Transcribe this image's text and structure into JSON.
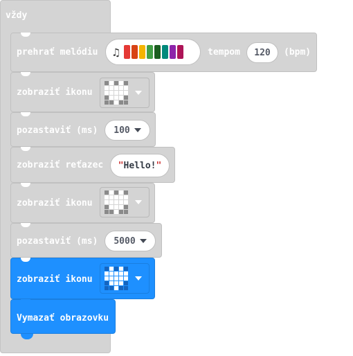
{
  "forever": {
    "label": "vždy"
  },
  "melody": {
    "label": "prehrať melódiu",
    "tempo_label": "tempom",
    "tempo_value": "120",
    "unit": "(bpm)",
    "note_icon": "music-note-icon",
    "colors": [
      "#e53935",
      "#d84315",
      "#f4b400",
      "#43a047",
      "#1b5e20",
      "#00897b",
      "#8e24aa",
      "#ad1457"
    ]
  },
  "show_icon_1": {
    "label": "zobraziť ikonu",
    "pattern": [
      0,
      1,
      0,
      1,
      0,
      1,
      1,
      1,
      1,
      1,
      1,
      1,
      1,
      1,
      1,
      0,
      1,
      1,
      1,
      0,
      0,
      0,
      1,
      0,
      0
    ]
  },
  "pause_1": {
    "label": "pozastaviť (ms)",
    "value": "100"
  },
  "show_string": {
    "label": "zobraziť reťazec",
    "quote_open": "\"",
    "text": "Hello!",
    "quote_close": "\""
  },
  "show_icon_2": {
    "label": "zobraziť ikonu",
    "pattern": [
      0,
      1,
      0,
      1,
      0,
      1,
      1,
      1,
      1,
      1,
      1,
      1,
      1,
      1,
      1,
      0,
      1,
      1,
      1,
      0,
      0,
      0,
      1,
      0,
      0
    ]
  },
  "pause_2": {
    "label": "pozastaviť (ms)",
    "value": "5000"
  },
  "show_icon_3": {
    "label": "zobraziť ikonu",
    "pattern": [
      0,
      1,
      0,
      1,
      0,
      1,
      1,
      1,
      1,
      1,
      1,
      1,
      1,
      1,
      1,
      0,
      1,
      1,
      1,
      0,
      0,
      0,
      1,
      0,
      0
    ]
  },
  "clear": {
    "label": "Vymazať obrazovku"
  },
  "colors": {
    "grey_block": "#d4d4d4",
    "blue_block": "#1e90ff"
  }
}
